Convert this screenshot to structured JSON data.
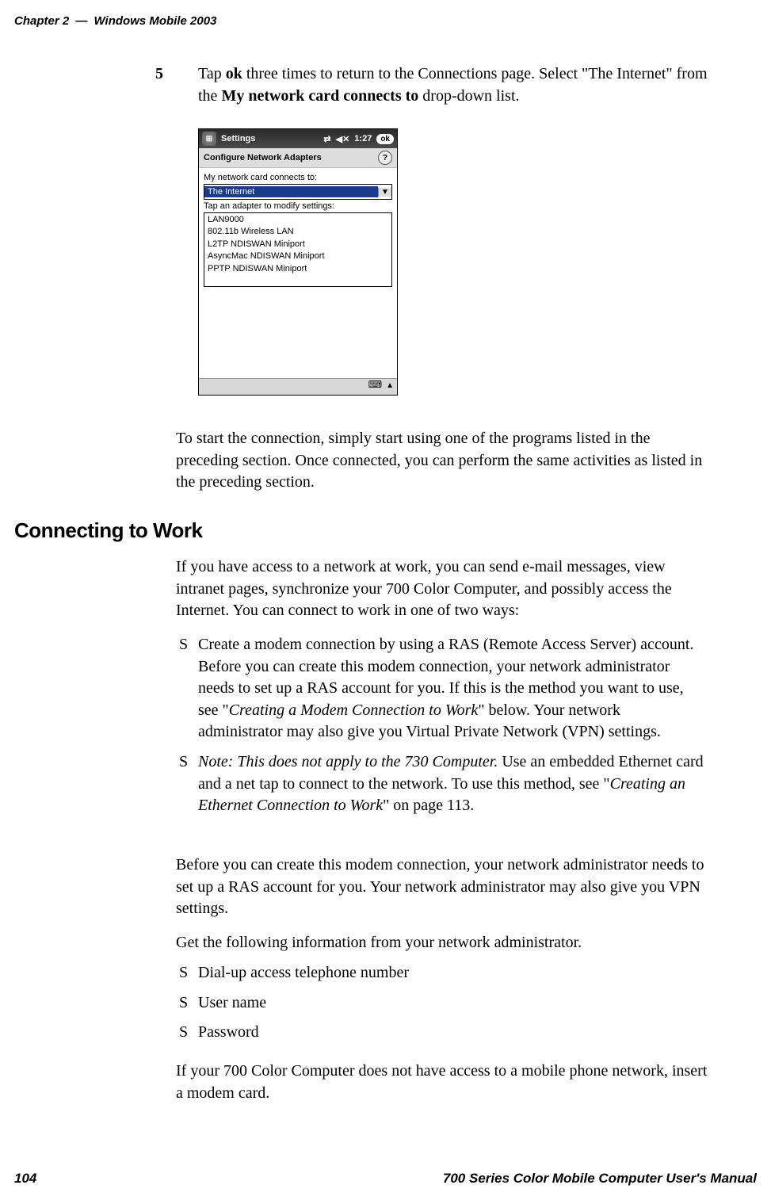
{
  "pageHeader": {
    "chapter": "Chapter 2",
    "dash": "—",
    "title": "Windows Mobile 2003"
  },
  "step5": {
    "number": "5",
    "pre": "Tap ",
    "ok": "ok",
    "mid": " three times to return to the Connections page. Select \"The Internet\" from the ",
    "bold2": "My network card connects to",
    "post": " drop-down list."
  },
  "wm": {
    "title": "Settings",
    "time": "1:27",
    "okLabel": "ok",
    "sub": "Configure Network Adapters",
    "label1": "My network card connects to:",
    "selected": "The Internet",
    "label2": "Tap an adapter to modify settings:",
    "adapters": [
      "LAN9000",
      "802.11b Wireless LAN",
      "L2TP NDISWAN Miniport",
      "AsyncMac NDISWAN Miniport",
      "PPTP NDISWAN Miniport"
    ]
  },
  "para_after_shot": "To start the connection, simply start using one of the programs listed in the preceding section. Once connected, you can perform the same activities as listed in the preceding section.",
  "heading2": "Connecting to Work",
  "para_intro": "If you have access to a network at work, you can send e-mail messages, view intranet pages, synchronize your 700 Color Computer, and possibly access the Internet. You can connect to work in one of two ways:",
  "bullet1": {
    "pre": "Create a modem connection by using a RAS (Remote Access Server) account. Before you can create this modem connection, your network administrator needs to set up a RAS account for you. If this is the method you want to use, see \"",
    "ital": "Creating a Modem Connection to Work",
    "post": "\" below. Your network administrator may also give you Virtual Private Network (VPN) settings."
  },
  "bullet2": {
    "italNote": "Note: This does not apply to the 730 Computer.",
    "mid": " Use an embedded Ethernet card and a net tap to connect to the network. To use this method, see \"",
    "ital2": "Creating an Ethernet Connection to Work",
    "post": "\" on page 113."
  },
  "para_before2": "Before you can create this modem connection, your network administrator needs to set up a RAS account for you. Your network administrator may also give you VPN settings.",
  "para_getinfo": "Get the following information from your network administrator.",
  "bullets2": [
    "Dial-up access telephone number",
    "User name",
    "Password"
  ],
  "para_last": "If your 700 Color Computer does not have access to a mobile phone network, insert a modem card.",
  "footer": {
    "pagenum": "104",
    "title": "700 Series Color Mobile Computer User's Manual"
  }
}
